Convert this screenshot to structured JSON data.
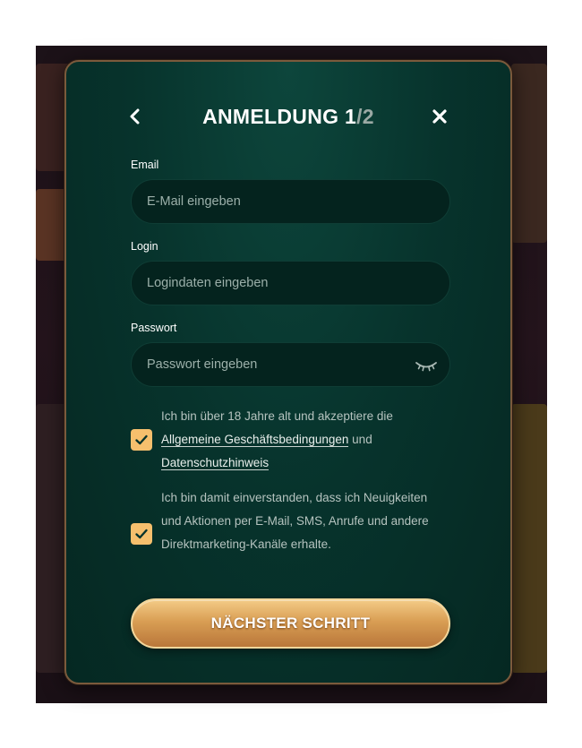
{
  "modal": {
    "title_main": "ANMELDUNG 1",
    "title_sep": "/",
    "title_total": "2",
    "back_icon": "chevron-left-icon",
    "close_icon": "close-icon"
  },
  "form": {
    "email": {
      "label": "Email",
      "placeholder": "E-Mail eingeben",
      "value": ""
    },
    "login": {
      "label": "Login",
      "placeholder": "Logindaten eingeben",
      "value": ""
    },
    "password": {
      "label": "Passwort",
      "placeholder": "Passwort eingeben",
      "value": "",
      "toggle_icon": "eye-closed-icon"
    }
  },
  "consents": {
    "age": {
      "checked": true,
      "text_before": "Ich bin über 18 Jahre alt und akzeptiere die",
      "terms_link": "Allgemeine Geschäftsbedingungen",
      "text_middle": "und",
      "privacy_link": "Datenschutzhinweis"
    },
    "marketing": {
      "checked": true,
      "text": "Ich bin damit einverstanden, dass ich Neuigkeiten und Aktionen per E-Mail, SMS, Anrufe und andere Direktmarketing-Kanäle erhalte."
    }
  },
  "actions": {
    "next_label": "NÄCHSTER SCHRITT"
  },
  "colors": {
    "modal_bg": "#07332c",
    "modal_border": "#7b5a3c",
    "checkbox": "#f6bf6d",
    "button_gold": "#d99e54",
    "title_muted": "#9aa9a4"
  }
}
